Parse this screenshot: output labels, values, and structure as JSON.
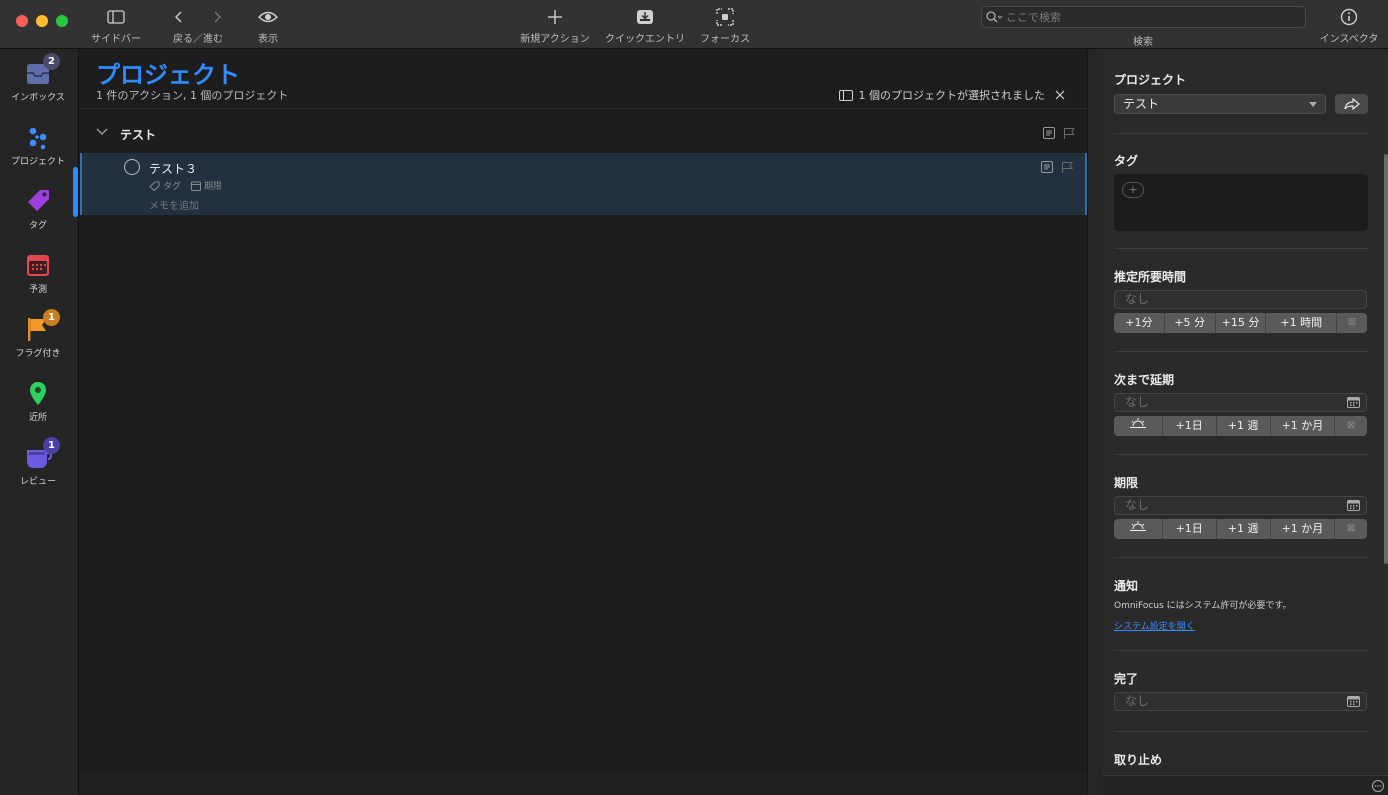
{
  "window": {
    "traffic_lights": {
      "close": "#fe5f57",
      "minimize": "#febc2e",
      "zoom": "#28c840"
    }
  },
  "toolbar": {
    "sidebar_label": "サイドバー",
    "back_forward_label": "戻る／進む",
    "view_label": "表示",
    "new_action_label": "新規アクション",
    "quick_entry_label": "クイックエントリ",
    "focus_label": "フォーカス",
    "search_placeholder": "ここで検索",
    "search_label": "検索",
    "inspector_label": "インスペクタ"
  },
  "sidebar": {
    "accent_color": "#2f8cff",
    "items": [
      {
        "label": "インボックス",
        "icon": "inbox-icon",
        "badge": "2",
        "badge_color": "#4a4a6a"
      },
      {
        "label": "プロジェクト",
        "icon": "projects-icon",
        "badge": "",
        "active": true
      },
      {
        "label": "タグ",
        "icon": "tag-icon",
        "badge": ""
      },
      {
        "label": "予測",
        "icon": "forecast-calendar-icon",
        "badge": ""
      },
      {
        "label": "フラグ付き",
        "icon": "flag-icon",
        "badge": "1",
        "badge_color": "#c58021"
      },
      {
        "label": "近所",
        "icon": "location-pin-icon",
        "badge": ""
      },
      {
        "label": "レビュー",
        "icon": "review-icon",
        "badge": "1",
        "badge_color": "#4b3fa8"
      }
    ]
  },
  "main": {
    "title": "プロジェクト",
    "subtitle": "1 件のアクション, 1 個のプロジェクト",
    "selection_info": "1 個のプロジェクトが選択されました",
    "group": {
      "title": "テスト"
    },
    "task": {
      "title": "テスト３",
      "tag_placeholder": "タグ",
      "due_placeholder": "期限",
      "note_placeholder": "メモを追加"
    }
  },
  "inspector": {
    "project": {
      "title": "プロジェクト",
      "value": "テスト"
    },
    "tags": {
      "title": "タグ",
      "add_label": "+"
    },
    "estimate": {
      "title": "推定所要時間",
      "placeholder": "なし",
      "buttons": [
        "+1分",
        "+5 分",
        "+15 分",
        "+1 時間"
      ]
    },
    "defer": {
      "title": "次まで延期",
      "placeholder": "なし",
      "buttons": [
        "+1日",
        "+1 週",
        "+1 か月"
      ]
    },
    "due": {
      "title": "期限",
      "placeholder": "なし",
      "buttons": [
        "+1日",
        "+1 週",
        "+1 か月"
      ]
    },
    "notification": {
      "title": "通知",
      "description": "OmniFocus にはシステム許可が必要です。",
      "link": "システム設定を開く"
    },
    "completed": {
      "title": "完了",
      "placeholder": "なし"
    },
    "dropped": {
      "title": "取り止め"
    }
  }
}
